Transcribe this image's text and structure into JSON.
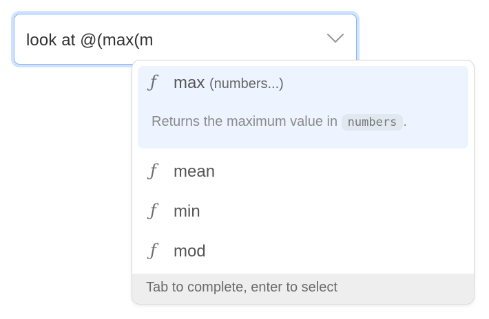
{
  "input": {
    "value": "look at @(max(m",
    "chevron_icon": "chevron-down-icon"
  },
  "dropdown": {
    "icon_glyph": "ƒ",
    "icon_name": "function-icon",
    "items": [
      {
        "name": "max",
        "signature": "(numbers...)",
        "description_prefix": "Returns the maximum value in",
        "description_code": "numbers",
        "description_suffix": ".",
        "active": true
      },
      {
        "name": "mean"
      },
      {
        "name": "min"
      },
      {
        "name": "mod"
      }
    ],
    "footer": "Tab to complete, enter to select"
  },
  "colors": {
    "focus_ring": "#cfe2ff",
    "focus_border": "#8ab4f8",
    "active_item_bg": "#edf4ff",
    "footer_bg": "#eeeeee"
  }
}
